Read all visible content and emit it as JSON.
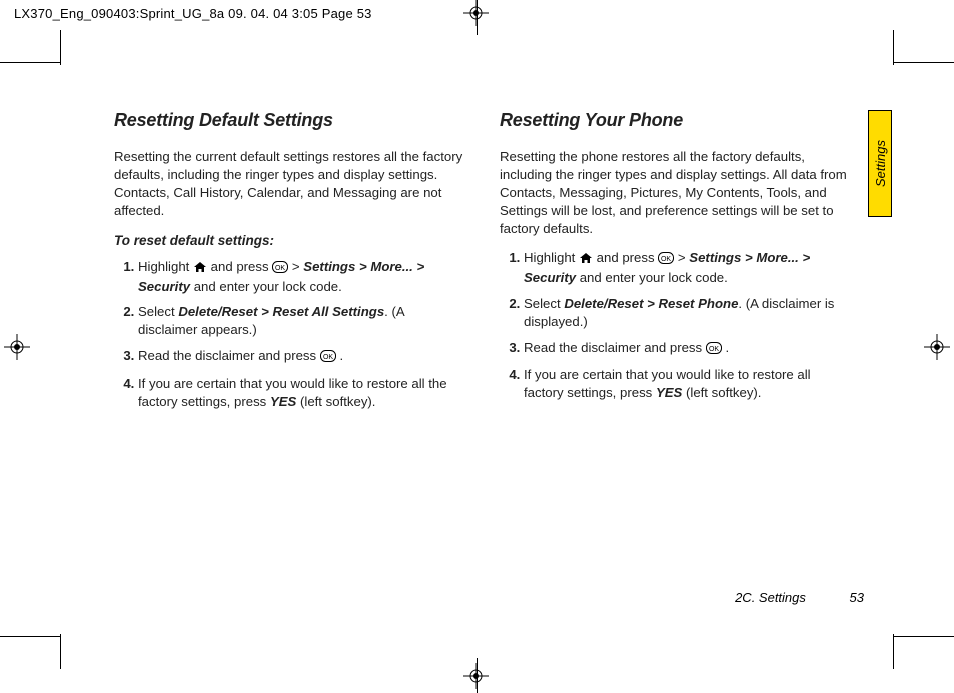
{
  "printHeader": "LX370_Eng_090403:Sprint_UG_8a  09. 04. 04   3:05   Page 53",
  "sideTab": "Settings",
  "left": {
    "heading": "Resetting Default Settings",
    "intro": "Resetting the current default settings restores all the factory defaults, including the ringer types and display settings. Contacts, Call History, Calendar, and Messaging are not affected.",
    "subhead": "To reset default settings:",
    "step1_a": "Highlight ",
    "step1_b": " and press ",
    "step1_c": " > ",
    "step1_path": "Settings > More... > Security",
    "step1_d": " and enter your lock code.",
    "step2_a": "Select ",
    "step2_path": "Delete/Reset > Reset All Settings",
    "step2_b": ". (A disclaimer appears.)",
    "step3_a": "Read the disclaimer and press ",
    "step3_b": " .",
    "step4_a": "If you are certain that you would like to restore all the factory settings, press ",
    "step4_yes": "YES",
    "step4_b": " (left softkey)."
  },
  "right": {
    "heading": "Resetting Your Phone",
    "intro": "Resetting the phone restores all the factory defaults, including the ringer types and display settings. All data from Contacts, Messaging, Pictures, My Contents, Tools, and Settings will be lost, and preference settings will be set to factory defaults.",
    "step1_a": "Highlight ",
    "step1_b": " and press ",
    "step1_c": " > ",
    "step1_path": "Settings > More... > Security",
    "step1_d": " and enter your lock code.",
    "step2_a": "Select ",
    "step2_path": "Delete/Reset > Reset Phone",
    "step2_b": ". (A disclaimer is displayed.)",
    "step3_a": "Read the disclaimer and press ",
    "step3_b": " .",
    "step4_a": "If you are certain that you would like to restore all factory settings, press ",
    "step4_yes": "YES",
    "step4_b": " (left softkey)."
  },
  "footer": {
    "chapter": "2C. Settings",
    "page": "53"
  }
}
